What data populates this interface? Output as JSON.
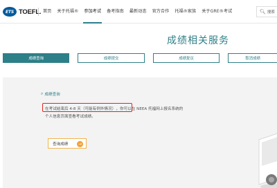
{
  "header": {
    "logo_ets": "ETS",
    "logo_toefl": "TOEFL.",
    "nav": [
      {
        "label": "首页",
        "active": false
      },
      {
        "label": "关于托福®",
        "active": false
      },
      {
        "label": "参加考试",
        "active": true
      },
      {
        "label": "备考指南",
        "active": false
      },
      {
        "label": "最新动态",
        "active": false
      },
      {
        "label": "官方合作",
        "active": false
      },
      {
        "label": "托福®家族",
        "active": false
      },
      {
        "label": "关于GRE®考试",
        "active": false
      }
    ],
    "search_label": "搜索",
    "accent_color": "#2d7f88"
  },
  "page": {
    "title": "成绩相关服务"
  },
  "tabs": [
    {
      "label": "成绩查询",
      "active": true
    },
    {
      "label": "成绩提交",
      "active": false
    },
    {
      "label": "成绩复议",
      "active": false
    },
    {
      "label": "取消成绩",
      "active": false
    }
  ],
  "content": {
    "section_label": "成绩查询",
    "highlight_text": "在考试结束后 4-8 天（可能有例外情况）",
    "line1_rest": "，你可以在 NEEA 托福网上报名系统的",
    "line2": "个人信息页面查看考试成绩。",
    "button_label": "查询成绩",
    "highlight_color": "#e2231a",
    "button_color": "#f1a23a"
  }
}
